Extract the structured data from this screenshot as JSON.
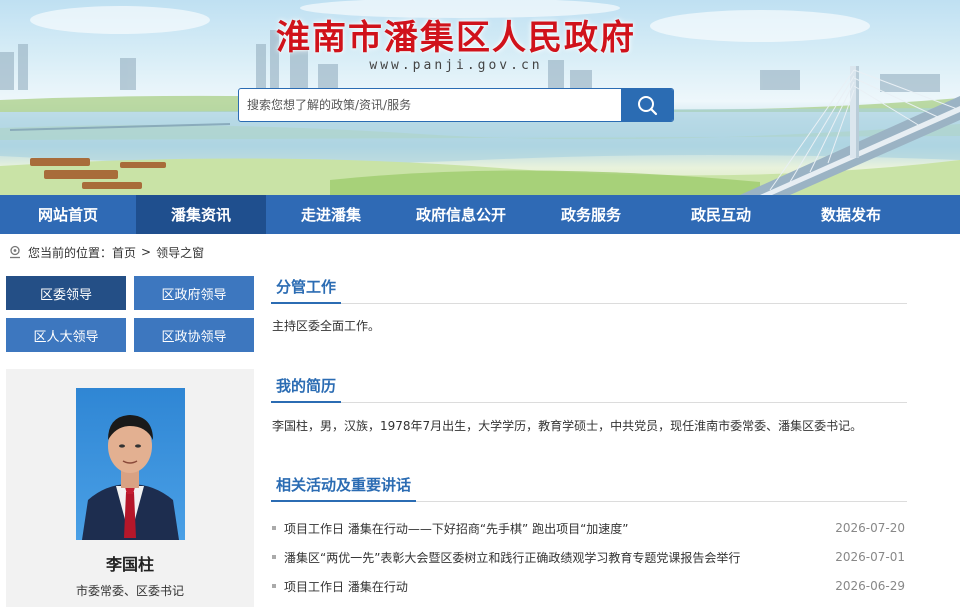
{
  "site": {
    "title": "淮南市潘集区人民政府",
    "url": "www.panji.gov.cn"
  },
  "search": {
    "placeholder": "搜索您想了解的政策/资讯/服务"
  },
  "nav": [
    {
      "label": "网站首页"
    },
    {
      "label": "潘集资讯"
    },
    {
      "label": "走进潘集"
    },
    {
      "label": "政府信息公开"
    },
    {
      "label": "政务服务"
    },
    {
      "label": "政民互动"
    },
    {
      "label": "数据发布"
    }
  ],
  "breadcrumb": {
    "prefix": "您当前的位置：",
    "home": "首页",
    "separator": ">",
    "current": "领导之窗"
  },
  "side_tabs": [
    {
      "label": "区委领导"
    },
    {
      "label": "区政府领导"
    },
    {
      "label": "区人大领导"
    },
    {
      "label": "区政协领导"
    }
  ],
  "profile": {
    "name": "李国柱",
    "title": "市委常委、区委书记"
  },
  "sections": {
    "duties": {
      "heading": "分管工作",
      "text": "主持区委全面工作。"
    },
    "resume": {
      "heading": "我的简历",
      "text": "李国柱，男，汉族，1978年7月出生，大学学历，教育学硕士，中共党员，现任淮南市委常委、潘集区委书记。"
    },
    "activities": {
      "heading": "相关活动及重要讲话",
      "items": [
        {
          "title": "项目工作日 潘集在行动——下好招商“先手棋” 跑出项目“加速度”",
          "date": "2026-07-20"
        },
        {
          "title": "潘集区“两优一先”表彰大会暨区委树立和践行正确政绩观学习教育专题党课报告会举行",
          "date": "2026-07-01"
        },
        {
          "title": "项目工作日 潘集在行动",
          "date": "2026-06-29"
        }
      ]
    }
  },
  "colors": {
    "nav": "#2f6ab5",
    "nav_active": "#1f4f8e",
    "title_red": "#d0121b",
    "accent_blue": "#2b6cb3"
  }
}
